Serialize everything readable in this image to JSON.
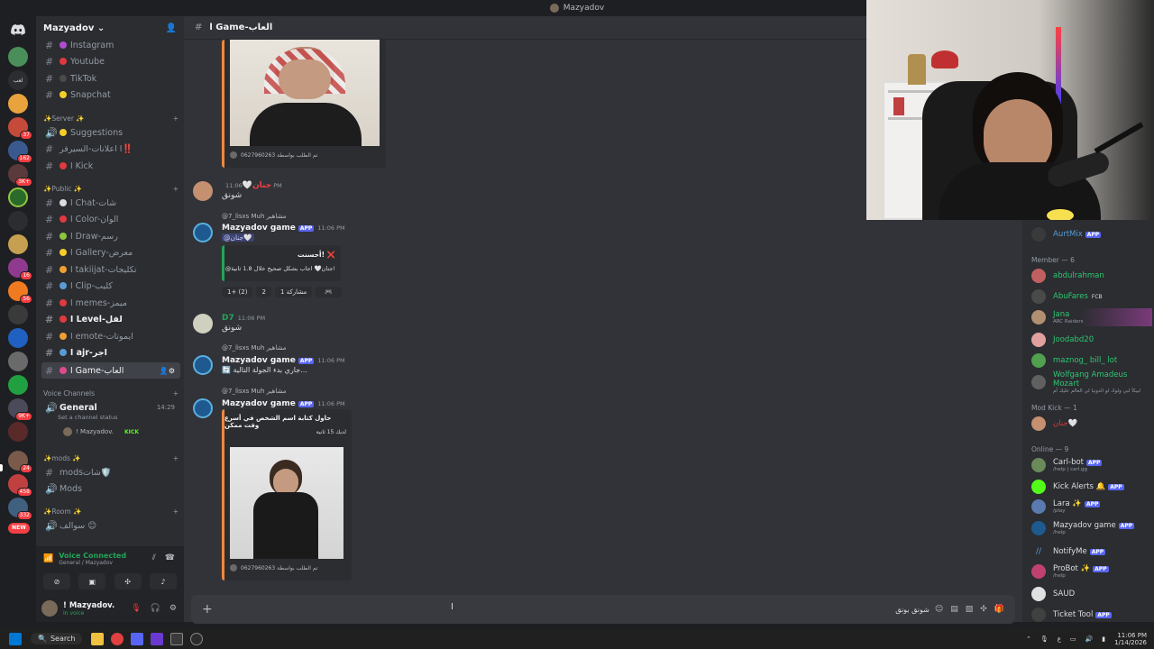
{
  "window": {
    "title": "Mazyadov"
  },
  "server": {
    "name": "Mazyadov"
  },
  "channels": {
    "top": [
      {
        "name": "Instagram",
        "color": "#b14cd1"
      },
      {
        "name": "Youtube",
        "color": "#e0393e"
      },
      {
        "name": "TikTok",
        "color": "#949ba4"
      },
      {
        "name": "Snapchat",
        "color": "#f7cd29"
      }
    ],
    "cat_server": "✨Server ✨",
    "server_items": [
      {
        "name": "Suggestions",
        "color": "#f7cd29"
      },
      {
        "name": "ا اعلانات-السيرفر‼️",
        "color": "#949ba4"
      },
      {
        "name": "ا Kick",
        "color": "#e0393e"
      }
    ],
    "cat_public": "✨Public ✨",
    "public_items": [
      {
        "name": "ا Chat-شات",
        "color": "#5a9bd5"
      },
      {
        "name": "ا Color-الوان",
        "color": "#e0393e"
      },
      {
        "name": "ا Draw-رسم",
        "color": "#8fc640"
      },
      {
        "name": "ا Gallery-معرض",
        "color": "#f7cd29"
      },
      {
        "name": "ا takiijat-تكليجات",
        "color": "#f0a030"
      },
      {
        "name": "ا Clip-كليب",
        "color": "#949ba4"
      },
      {
        "name": "ا memes-ميمز",
        "color": "#e0393e"
      },
      {
        "name": "ا Level-لفل",
        "color": "#e0393e"
      },
      {
        "name": "ا emote-ايموتات",
        "color": "#f0a030"
      },
      {
        "name": "ا ajr-اجر",
        "color": "#5a9bd5"
      },
      {
        "name": "ا Game-العاب",
        "color": "#e0498e"
      }
    ],
    "cat_voice": "Voice Channels",
    "voice": {
      "name": "General",
      "timer": "14:29",
      "status_placeholder": "Set a channel status",
      "user": "! Mazyadov.",
      "live": "KICK"
    },
    "cat_mods": "✨mods ✨",
    "mods_items": [
      "modsشات🛡️",
      "Mods"
    ],
    "cat_room": "✨Room ✨",
    "room_items": [
      "سوالف 😊"
    ]
  },
  "voice_panel": {
    "status": "Voice Connected",
    "location": "General / Mazyadov"
  },
  "user_panel": {
    "name": "! Mazyadov.",
    "status": "In voice"
  },
  "main": {
    "channel": "ا Game-العاب",
    "messages": {
      "embed1_footer": "تم الطلب بواسطة 0627960263",
      "m1_user": "جنان🤍",
      "m1_time": "11:06 PM",
      "m1_text": "شونق",
      "r1_reply": "@7_lisxs  Muh  مشاهير",
      "bot_name": "Mazyadov game",
      "bot_tag": "APP",
      "bot_time": "11:06 PM",
      "m2_mention": "@جنان🤍",
      "embed2_title": "أحسنت! ❌",
      "embed2_body": "@جنان🤍 اجاب بشكل صحيح خلال 1.8 ثانية!",
      "reactions": [
        "1+ (2)",
        "2",
        "مشاركة 1"
      ],
      "m3_user": "D7",
      "m3_time": "11:06 PM",
      "m3_text": "شونق",
      "r2_reply": "@7_lisxs  Muh  مشاهير",
      "m4_text": "جاري بدء الجولة التالية...",
      "r3_reply": "@7_lisxs  Muh  مشاهير",
      "embed3_title": "حاول كتابة اسم الشخص في أسرع وقت ممكن",
      "embed3_sub": "لديك 15 ثانية",
      "embed3_footer": "تم الطلب بواسطة 0627960263"
    },
    "composer_right": "شونق بونق"
  },
  "members": {
    "top": {
      "name": "AurtMix",
      "tag": "APP"
    },
    "member_header": "Member — 6",
    "member_list": [
      {
        "name": "abdulrahman",
        "color": "#2dc770",
        "sub": ""
      },
      {
        "name": "AbuFares",
        "color": "#2dc770",
        "sub": "",
        "badge": "FCB"
      },
      {
        "name": "Jana",
        "color": "#2dc770",
        "sub": "ARC Raiders"
      },
      {
        "name": "Joodabd20",
        "color": "#2dc770",
        "sub": ""
      },
      {
        "name": "maznog_ bill_ lot",
        "color": "#2dc770",
        "sub": ""
      },
      {
        "name": "Wolfgang Amadeus Mozart",
        "color": "#2dc770",
        "sub": "لبيكآ لبي ولوك لو الدونيا لي العالم عليك أم"
      }
    ],
    "modkick_header": "Mod Kick — 1",
    "modkick": {
      "name": "جنان🤍",
      "color": "#e0393e"
    },
    "online_header": "Online — 9",
    "online_list": [
      {
        "name": "Carl-bot",
        "tag": "APP",
        "sub": "/help | carl.gg"
      },
      {
        "name": "Kick Alerts 🔔",
        "tag": "APP",
        "sub": ""
      },
      {
        "name": "Lara ✨",
        "tag": "APP",
        "sub": "/play"
      },
      {
        "name": "Mazyadov game",
        "tag": "APP",
        "sub": "/help"
      },
      {
        "name": "NotifyMe",
        "tag": "APP",
        "sub": ""
      },
      {
        "name": "ProBot ✨",
        "tag": "APP",
        "sub": "/help"
      },
      {
        "name": "SAUD",
        "tag": "",
        "sub": ""
      },
      {
        "name": "Ticket Tool",
        "tag": "APP",
        "sub": ""
      }
    ]
  },
  "guild_badges": [
    "37",
    "162",
    "3K+",
    "16",
    "56",
    "9K+",
    "24",
    "458",
    "332",
    "NEW"
  ],
  "taskbar": {
    "search": "Search",
    "time": "11:06 PM",
    "date": "1/14/2026",
    "lang": "ع"
  }
}
